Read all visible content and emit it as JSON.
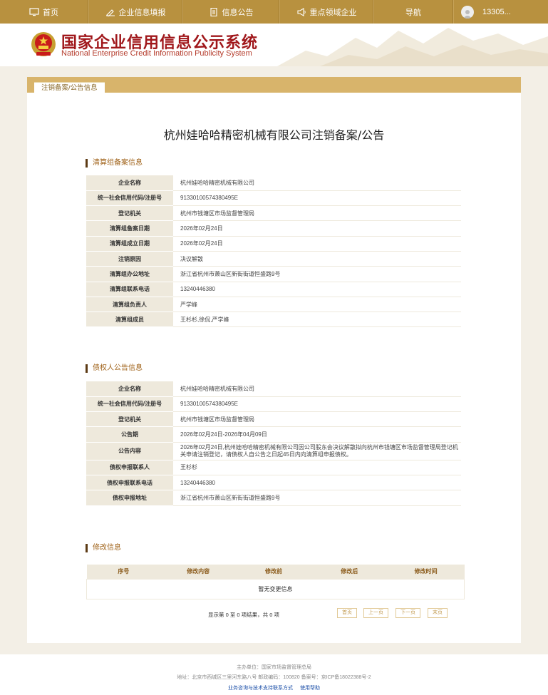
{
  "nav": {
    "items": [
      {
        "label": "首页",
        "icon": "monitor-icon"
      },
      {
        "label": "企业信息填报",
        "icon": "pen-icon"
      },
      {
        "label": "信息公告",
        "icon": "document-icon"
      },
      {
        "label": "重点领域企业",
        "icon": "megaphone-icon"
      },
      {
        "label": "导航",
        "icon": ""
      }
    ],
    "user": "13305..."
  },
  "site": {
    "title_cn": "国家企业信用信息公示系统",
    "title_en": "National Enterprise Credit Information Publicity System"
  },
  "tab_label": "注销备案/公告信息",
  "doc_title": "杭州娃哈哈精密机械有限公司注销备案/公告",
  "sections": {
    "liquidation": {
      "title": "清算组备案信息",
      "rows": [
        {
          "k": "企业名称",
          "v": "杭州娃哈哈精密机械有限公司"
        },
        {
          "k": "统一社会信用代码/注册号",
          "v": "91330100574380495E"
        },
        {
          "k": "登记机关",
          "v": "杭州市钱塘区市场监督管理局"
        },
        {
          "k": "清算组备案日期",
          "v": "2026年02月24日"
        },
        {
          "k": "清算组成立日期",
          "v": "2026年02月24日"
        },
        {
          "k": "注销原因",
          "v": "决议解散"
        },
        {
          "k": "清算组办公地址",
          "v": "浙江省杭州市萧山区新街街道恒盛路9号"
        },
        {
          "k": "清算组联系电话",
          "v": "13240446380"
        },
        {
          "k": "清算组负责人",
          "v": "严学峰"
        },
        {
          "k": "清算组成员",
          "v": "王杉杉,徐侃,严学峰"
        }
      ]
    },
    "creditor": {
      "title": "债权人公告信息",
      "rows": [
        {
          "k": "企业名称",
          "v": "杭州娃哈哈精密机械有限公司"
        },
        {
          "k": "统一社会信用代码/注册号",
          "v": "91330100574380495E"
        },
        {
          "k": "登记机关",
          "v": "杭州市钱塘区市场监督管理局"
        },
        {
          "k": "公告期",
          "v": "2026年02月24日-2026年04月09日"
        },
        {
          "k": "公告内容",
          "v": "2026年02月24日,杭州娃哈哈精密机械有限公司因公司股东会决议解散拟向杭州市钱塘区市场监督管理局登记机关申请注销登记，请债权人自公告之日起45日内向清算组申报债权。"
        },
        {
          "k": "债权申报联系人",
          "v": "王杉杉"
        },
        {
          "k": "债权申报联系电话",
          "v": "13240446380"
        },
        {
          "k": "债权申报地址",
          "v": "浙江省杭州市萧山区新街街道恒盛路9号"
        }
      ]
    },
    "modification": {
      "title": "修改信息",
      "headers": [
        "序号",
        "修改内容",
        "修改前",
        "修改后",
        "修改时间"
      ],
      "empty_text": "暂无变更信息"
    }
  },
  "pager": {
    "info": "显示第 0 至 0 项结果，共 0 项",
    "first": "首页",
    "prev": "上一页",
    "next": "下一页",
    "last": "末页"
  },
  "footer": {
    "sponsor": "主办单位：国家市场监督管理总局",
    "address": "地址：北京市西城区三里河东路八号   邮政编码：100820   备案号：京ICP备18022388号-2",
    "contact_link": "业务咨询与技术支持联系方式",
    "help_link": "使用帮助"
  },
  "colors": {
    "nav_bg": "#b8913f",
    "title_red": "#a0171b",
    "card_head": "#d8b46b",
    "key_cell": "#eee9dc"
  }
}
